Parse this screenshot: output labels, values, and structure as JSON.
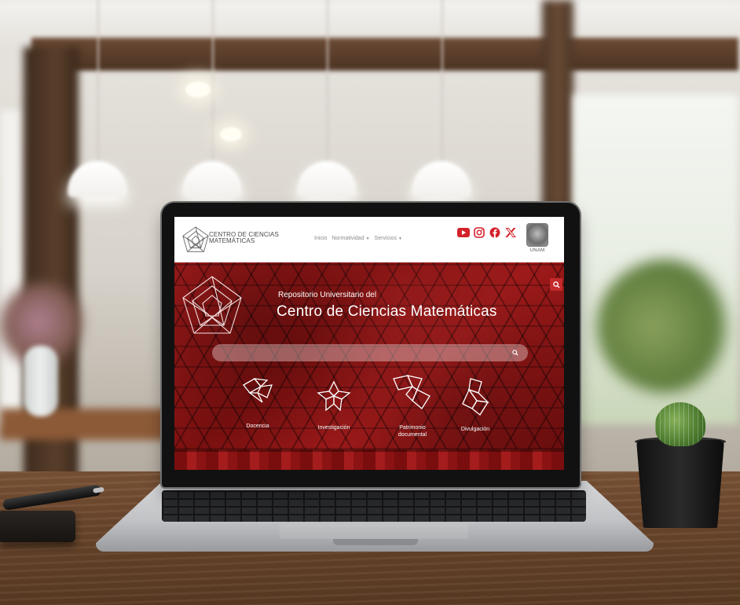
{
  "site": {
    "logo_line1": "CENTRO DE CIENCIAS",
    "logo_line2": "MATEMÁTICAS",
    "nav": [
      {
        "label": "Inicio",
        "has_menu": false
      },
      {
        "label": "Normatividad",
        "has_menu": true
      },
      {
        "label": "Servicios",
        "has_menu": true
      }
    ],
    "social_icons": [
      "youtube-icon",
      "instagram-icon",
      "facebook-icon",
      "x-icon"
    ],
    "institution": "UNAM",
    "colors": {
      "brand_red": "#c42a2a",
      "hero_red": "#8f1616",
      "social_red": "#d3212b"
    }
  },
  "hero": {
    "subtitle": "Repositorio Universitario del",
    "title": "Centro de Ciencias Matemáticas",
    "search_placeholder": ""
  },
  "categories": [
    {
      "label_line1": "Docencia",
      "label_line2": ""
    },
    {
      "label_line1": "Investigación",
      "label_line2": ""
    },
    {
      "label_line1": "Patrimonio",
      "label_line2": "documental"
    },
    {
      "label_line1": "Divulgación",
      "label_line2": ""
    }
  ]
}
